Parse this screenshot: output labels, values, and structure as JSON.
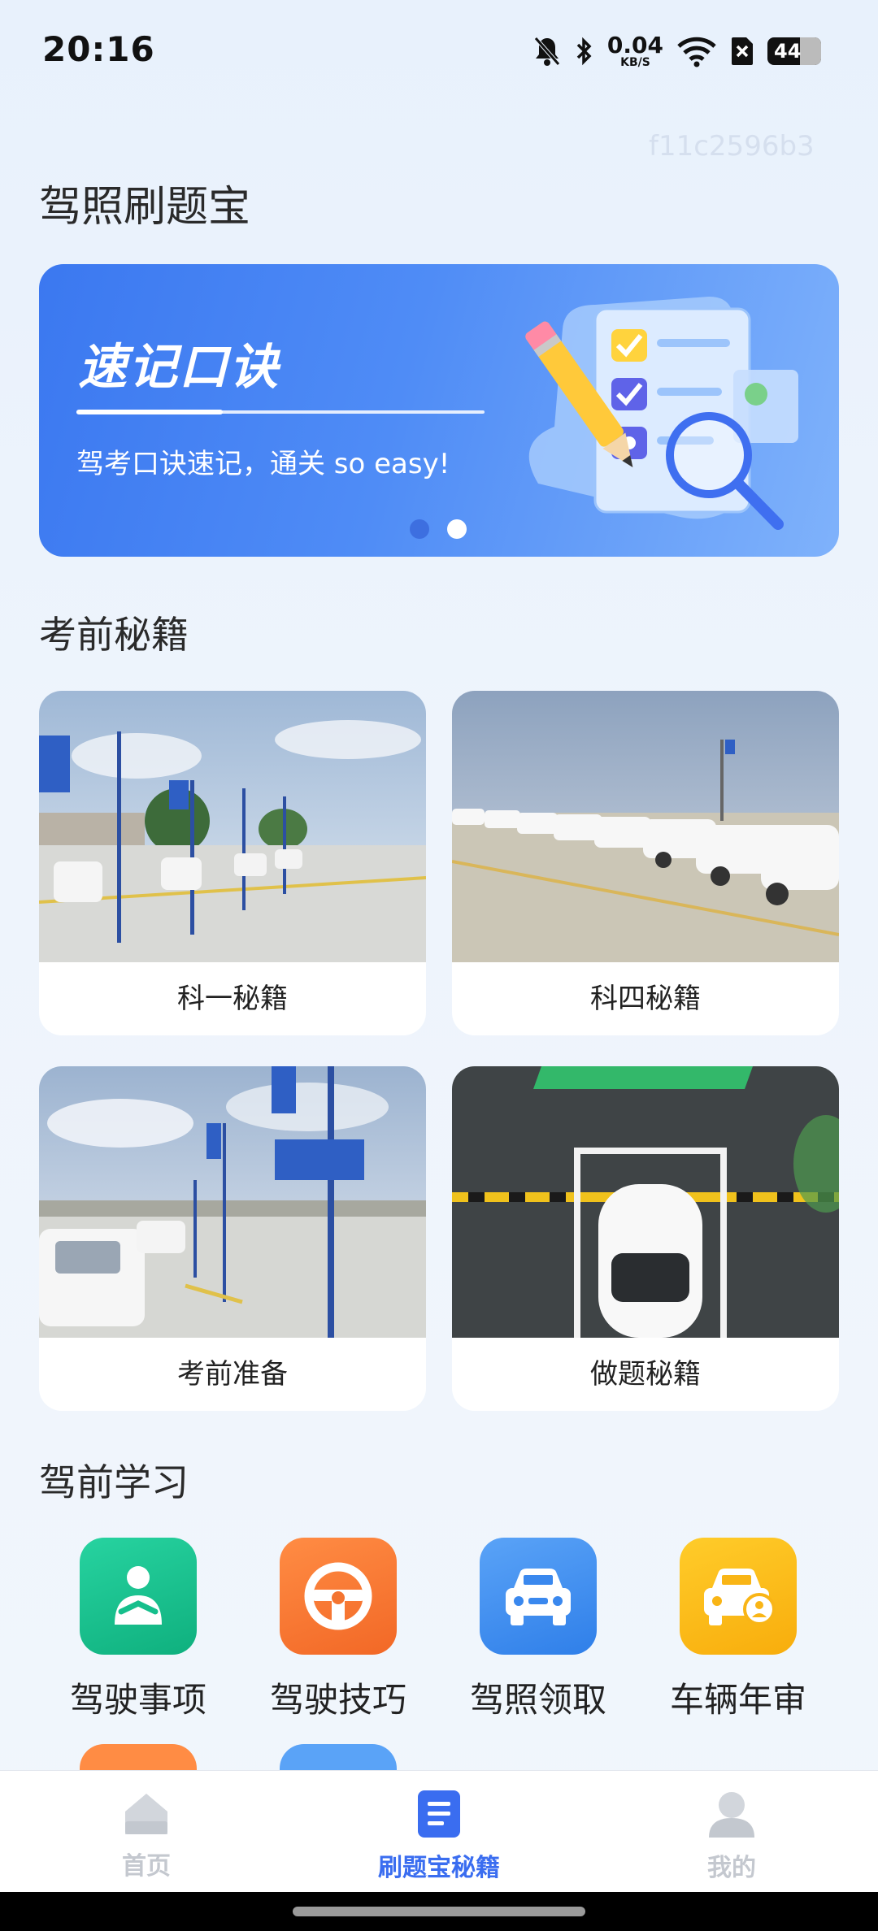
{
  "status_bar": {
    "time": "20:16",
    "net_speed_value": "0.04",
    "net_speed_unit": "KB/S",
    "battery_level": "44",
    "icons": [
      "mute-bell-icon",
      "bluetooth-icon",
      "wifi-icon",
      "sim-blocked-icon",
      "battery-icon"
    ]
  },
  "watermark": "f11c2596b3",
  "page_title": "驾照刷题宝",
  "banner": {
    "title": "速记口诀",
    "subtitle": "驾考口诀速记，通关 so easy!",
    "slide_count": 2,
    "active_slide": 2,
    "colors": {
      "start": "#3b78f0",
      "end": "#7fb2fb"
    }
  },
  "sections": {
    "exam_secrets": {
      "title": "考前秘籍",
      "cards": [
        {
          "label": "科一秘籍",
          "image": "driving-test-yard-photo"
        },
        {
          "label": "科四秘籍",
          "image": "parked-training-cars-photo"
        },
        {
          "label": "考前准备",
          "image": "test-route-sign-photo"
        },
        {
          "label": "做题秘籍",
          "image": "parking-space-car-photo"
        }
      ]
    },
    "pre_drive": {
      "title": "驾前学习",
      "items": [
        {
          "label": "驾驶事项",
          "icon": "driver-seated-icon",
          "color": "#17c08e"
        },
        {
          "label": "驾驶技巧",
          "icon": "steering-wheel-icon",
          "color": "#ff7a35"
        },
        {
          "label": "驾照领取",
          "icon": "car-front-icon",
          "color": "#3f8bf0"
        },
        {
          "label": "车辆年审",
          "icon": "car-inspection-icon",
          "color": "#ffbd1e"
        }
      ]
    }
  },
  "bottom_nav": {
    "items": [
      {
        "label": "首页",
        "icon": "home-icon",
        "active": false
      },
      {
        "label": "刷题宝秘籍",
        "icon": "document-list-icon",
        "active": true
      },
      {
        "label": "我的",
        "icon": "profile-icon",
        "active": false
      }
    ],
    "active_color": "#3a6df0",
    "inactive_color": "#c4c8cf"
  }
}
